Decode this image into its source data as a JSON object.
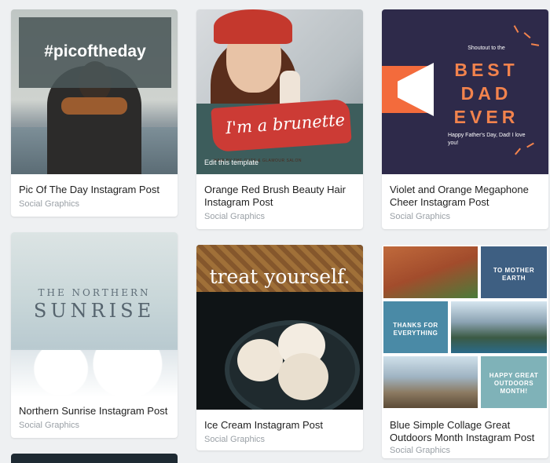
{
  "cards": [
    {
      "title": "Pic Of The Day Instagram Post",
      "category": "Social Graphics",
      "thumb_text": "#picoftheday"
    },
    {
      "title": "Orange Red Brush Beauty Hair Instagram Post",
      "category": "Social Graphics",
      "thumb_text": "I'm a brunette",
      "thumb_subtext": "HAIR BY THE CUTS & GLAMOUR SALON",
      "hover_label": "Edit this template"
    },
    {
      "title": "Violet and Orange Megaphone Cheer Instagram Post",
      "category": "Social Graphics",
      "thumb_top": "Shoutout to the",
      "thumb_main": "BEST DAD EVER",
      "thumb_bottom": "Happy Father's Day, Dad! I love you!"
    },
    {
      "title": "Northern Sunrise Instagram Post",
      "category": "Social Graphics",
      "thumb_top": "THE NORTHERN",
      "thumb_main": "SUNRISE"
    },
    {
      "title": "Ice Cream Instagram Post",
      "category": "Social Graphics",
      "thumb_text": "treat yourself."
    },
    {
      "title": "Blue Simple Collage Great Outdoors Month Instagram Post",
      "category": "Social Graphics",
      "tile_1": "TO MOTHER EARTH",
      "tile_2": "THANKS FOR EVERYTHING",
      "tile_3": "HAPPY GREAT OUTDOORS MONTH!"
    }
  ],
  "colors": {
    "background": "#eef0f2",
    "card": "#ffffff",
    "subtitle": "#9aa0a6",
    "accent_orange": "#f2834d",
    "violet": "#2e2a4a",
    "collage_blue": "#3e5f82"
  }
}
